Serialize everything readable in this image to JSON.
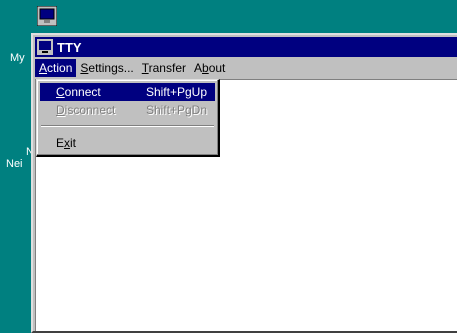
{
  "window": {
    "title": "TTY"
  },
  "menubar": {
    "items": [
      {
        "label": "Action",
        "mnemonic": "A",
        "rest": "ction"
      },
      {
        "label": "Settings...",
        "mnemonic": "S",
        "rest": "ettings..."
      },
      {
        "label": "Transfer",
        "mnemonic": "T",
        "rest": "ransfer"
      },
      {
        "label": "About",
        "pre": "A",
        "mnemonic": "b",
        "rest": "out"
      }
    ]
  },
  "action_menu": {
    "connect": {
      "pre": "",
      "mnemonic": "C",
      "rest": "onnect",
      "shortcut": "Shift+PgUp"
    },
    "disconnect": {
      "pre": "",
      "mnemonic": "D",
      "rest": "isconnect",
      "shortcut": "Shift+PgDn"
    },
    "exit": {
      "pre": "E",
      "mnemonic": "x",
      "rest": "it"
    }
  },
  "desktop": {
    "label1": "My",
    "label2a": "N",
    "label2b": "Nei"
  },
  "colors": {
    "desktop": "#008080",
    "titlebar": "#000080",
    "highlight": "#000080",
    "face": "#c0c0c0"
  }
}
